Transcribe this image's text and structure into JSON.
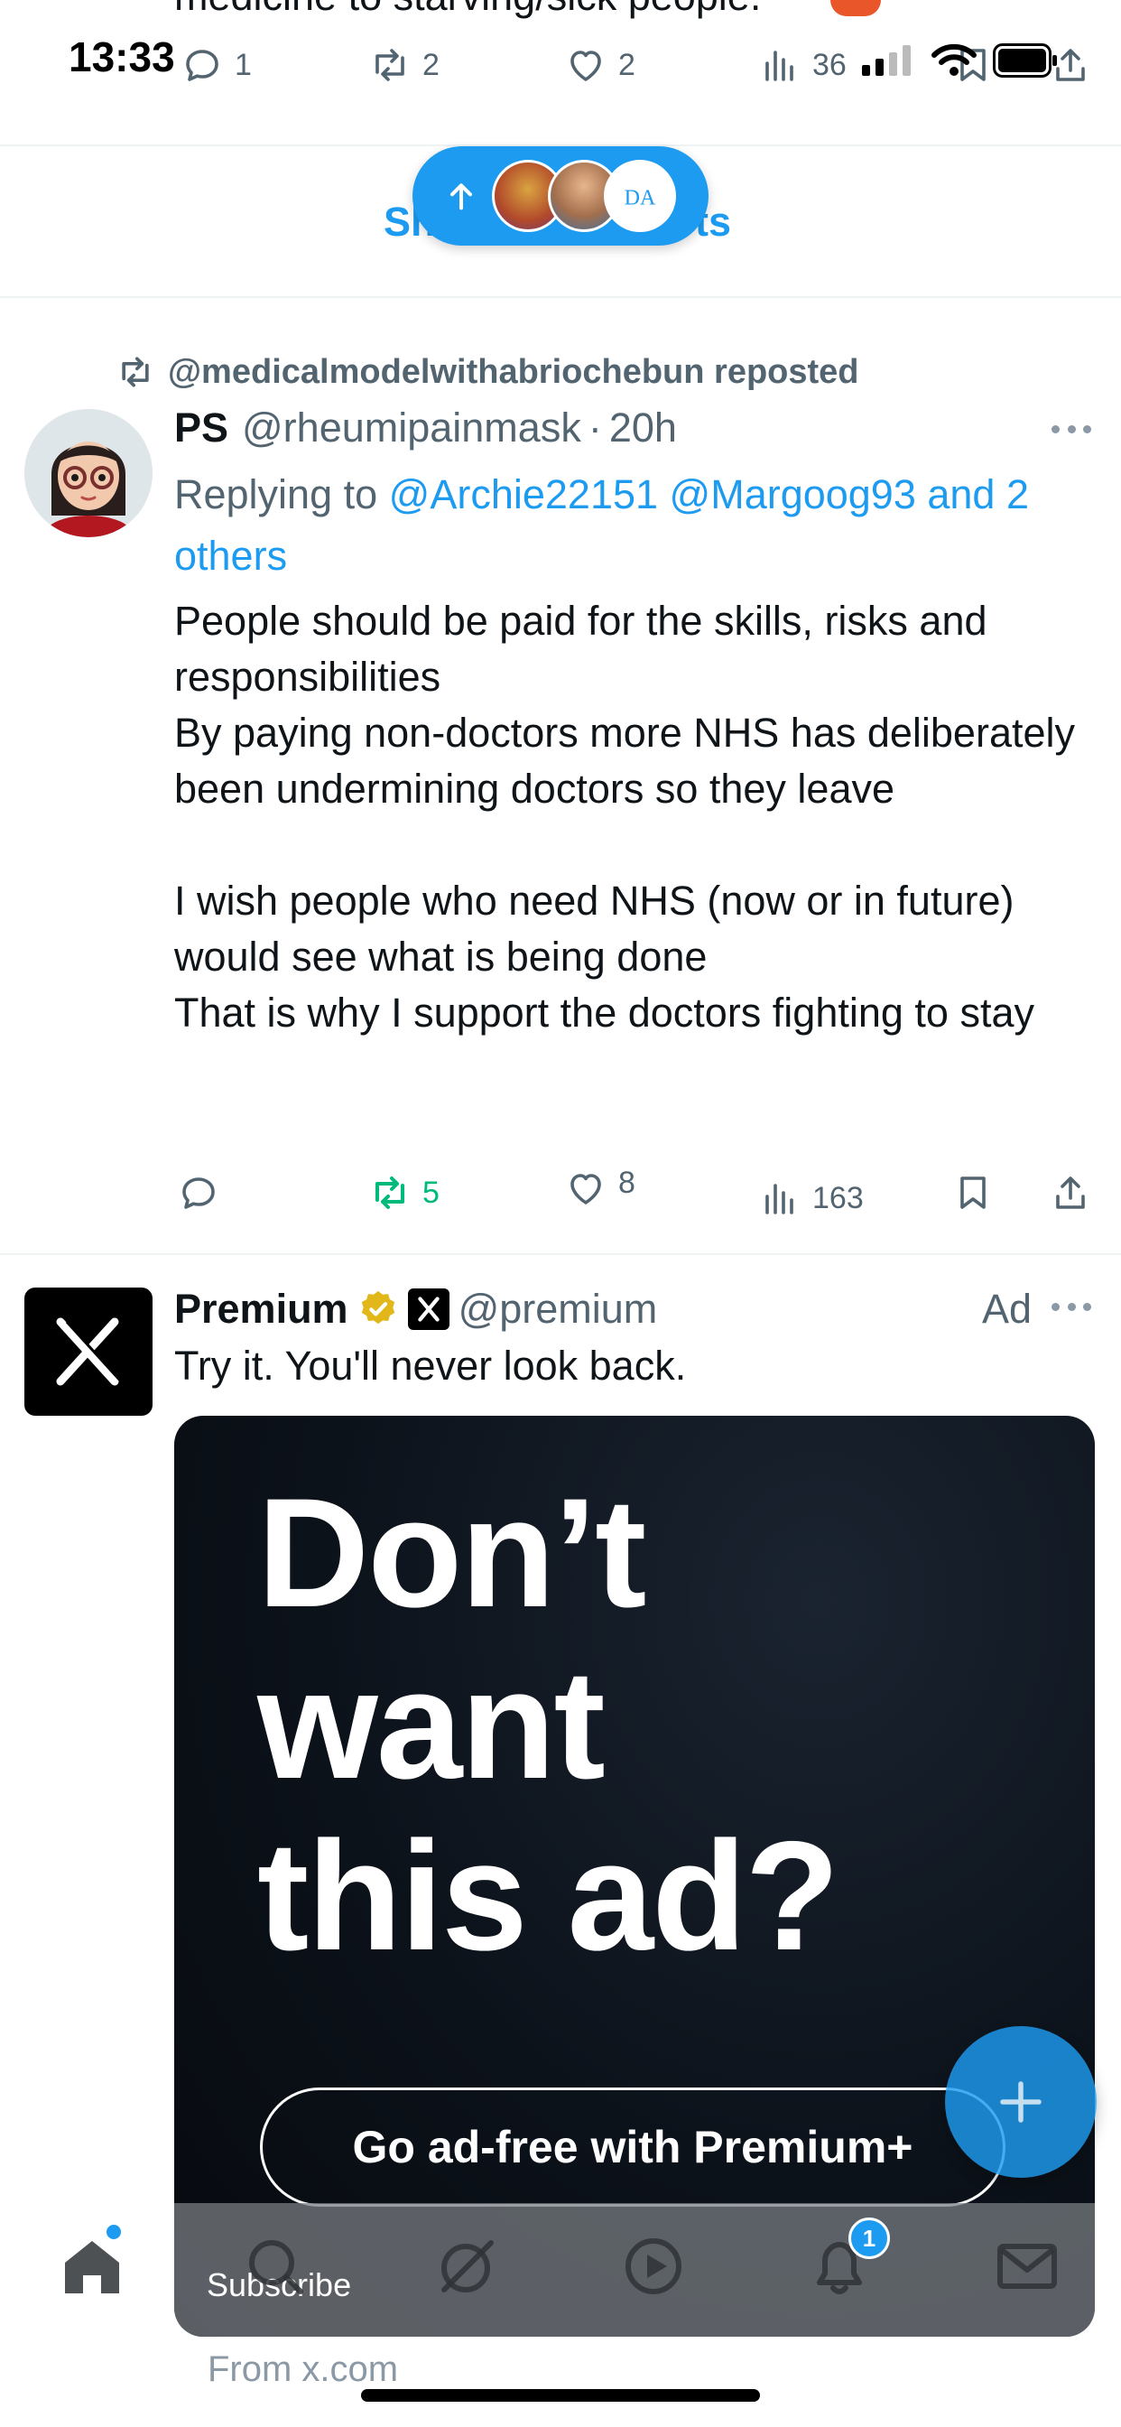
{
  "status_bar": {
    "time": "13:33"
  },
  "prev_tweet": {
    "partial_text": "medicine to starving/sick people.",
    "reply_count": "1",
    "retweet_count": "2",
    "like_count": "2",
    "view_count": "36"
  },
  "show_posts": {
    "label_left": "Sh",
    "label_right": "ts"
  },
  "repost_tweet": {
    "repost_label": "@medicalmodelwithabriochebun reposted",
    "author_name": "PS",
    "author_handle": "@rheumipainmask",
    "separator": "·",
    "time": "20h",
    "replying_prefix": "Replying to",
    "replying_users": "@Archie22151 @Margoog93 and 2",
    "replying_users_cont": "others",
    "body": "People should be paid for the skills, risks and responsibilities\nBy paying non-doctors more NHS has deliberately been undermining doctors so they leave\n\nI wish people who need NHS (now or in future) would see what is being done\nThat is why I support the doctors fighting to stay",
    "retweet_count": "5",
    "like_count": "8",
    "view_count": "163"
  },
  "ad_tweet": {
    "author_name": "Premium",
    "author_handle": "@premium",
    "ad_label": "Ad",
    "text": "Try it. You'll never look back.",
    "card_headline_1": "Don’t",
    "card_headline_2": "want",
    "card_headline_3": "this ad?",
    "card_cta": "Go ad-free with Premium+",
    "card_subscribe": "Subscribe",
    "card_source": "From x.com"
  },
  "bottom_nav": {
    "notification_badge": "1"
  },
  "colors": {
    "accent": "#1d9bf0",
    "retweet_green": "#00ba7c",
    "text_primary": "#0f1419",
    "text_secondary": "#536471",
    "verified_gold": "#e2b719",
    "ad_card_bg": "#0c121a"
  }
}
